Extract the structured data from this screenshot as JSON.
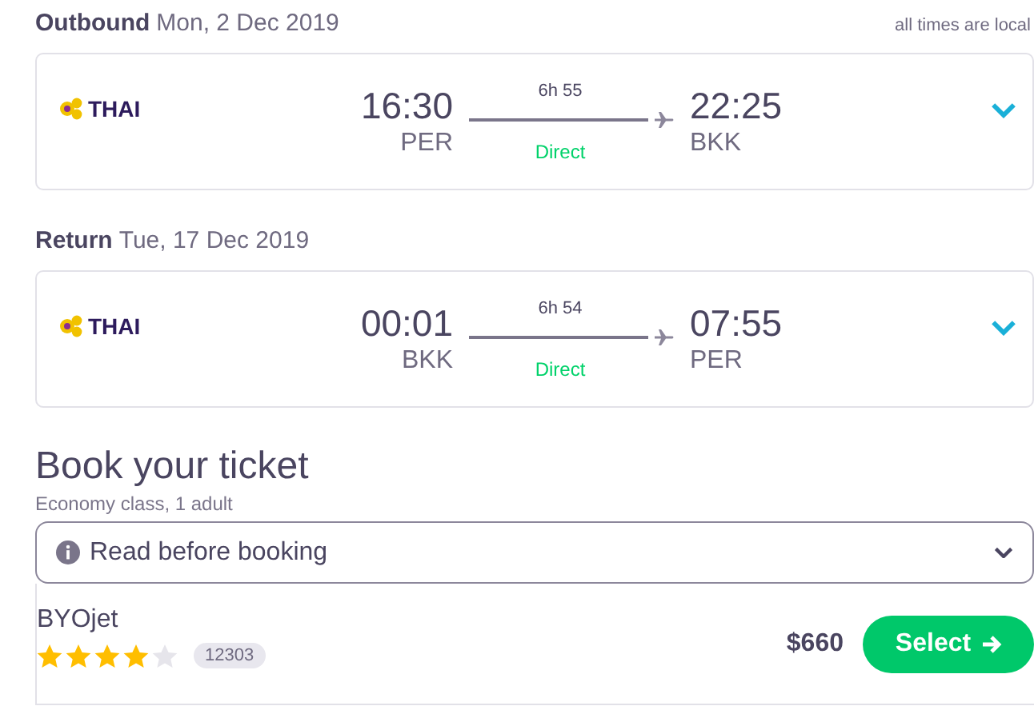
{
  "legs": [
    {
      "label": "Outbound",
      "date": "Mon, 2 Dec 2019",
      "note": "all times are local",
      "airline": "THAI",
      "depart_time": "16:30",
      "depart_airport": "PER",
      "duration": "6h 55",
      "stops": "Direct",
      "arrive_time": "22:25",
      "arrive_airport": "BKK",
      "expanded": false
    },
    {
      "label": "Return",
      "date": "Tue, 17 Dec 2019",
      "airline": "THAI",
      "depart_time": "00:01",
      "depart_airport": "BKK",
      "duration": "6h 54",
      "stops": "Direct",
      "arrive_time": "07:55",
      "arrive_airport": "PER",
      "expanded": false
    }
  ],
  "booking": {
    "title": "Book your ticket",
    "subtitle": "Economy class, 1 adult",
    "notice": {
      "label": "Read before booking",
      "expanded": false
    },
    "offers": [
      {
        "provider": "BYOjet",
        "stars": 4,
        "reviews": "12303",
        "price": "$660",
        "button": "Select"
      }
    ]
  }
}
